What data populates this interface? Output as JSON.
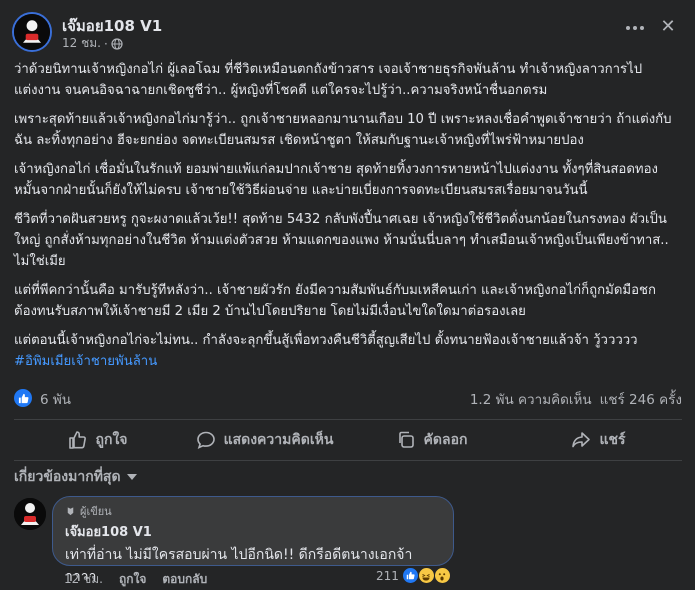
{
  "post": {
    "author": "เจ๊มอย108 V1",
    "time": "12 ชม.",
    "paragraphs": [
      "ว่าด้วยนิทานเจ้าหญิงกอไก่ ผู้เลอโฉม ที่ชีวิตเหมือนตกถังข้าวสาร เจอเจ้าชายธุรกิจพันล้าน ทำเจ้าหญิงลาวการไปแต่งงาน จนคนอิจฉาฉายกเชิดชูชีว่า.. ผู้หญิงที่โชคดี แต่ใครจะไปรู้ว่า..ความจริงหน้าชื่นอกตรม",
      "เพราะสุดท้ายแล้วเจ้าหญิงกอไก่มารู้ว่า.. ถูกเจ้าชายหลอกมานานเกือบ 10 ปี เพราะหลงเชื่อคำพูดเจ้าชายว่า ถ้าแต่งกับฉัน ละทิ้งทุกอย่าง ฮีจะยกย่อง จดทะเบียนสมรส เชิดหน้าชูตา ให้สมกับฐานะเจ้าหญิงที่ไพร่ฟ้าหมายปอง",
      "เจ้าหญิงกอไก่ เชื่อมั่นในรักแท้ ยอมพ่ายแพ้แก่ลมปากเจ้าชาย สุดท้ายทิ้งวงการหายหน้าไปแต่งงาน ทั้งๆที่สินสอดทองหมั้นจากฝ่ายนั้นก็ยังให้ไม่ครบ เจ้าชายใช้วิธีผ่อนจ่าย และบ่ายเบี่ยงการจดทะเบียนสมรสเรื่อยมาจนวันนี้",
      "ชีวิตที่วาดฝันสวยหรู กูจะผงาดแล้วเว้ย!! สุดท้าย 5432 กลับพังปี้นาศเฉย เจ้าหญิงใช้ชีวิตดั่งนกน้อยในกรงทอง ผัวเป็นใหญ่ ถูกสั่งห้ามทุกอย่างในชีวิต ห้ามแต่งตัวสวย ห้ามแดกของแพง ห้ามนั่นนี่บลาๆ ทำเสมือนเจ้าหญิงเป็นเพียงข้าทาส.. ไม่ใช่เมีย",
      "แต่ที่พีคกว่านั้นคือ มารับรู้ทีหลังว่า.. เจ้าชายผัวรัก ยังมีความสัมพันธ์กับมเหสีคนเก่า และเจ้าหญิงกอไก่ก็ถูกมัดมือชก ต้องทนรับสภาพให้เจ้าชายมี 2 เมีย 2 บ้านไปโดยปริยาย โดยไม่มีเงื่อนไขใดใดมาต่อรองเลย",
      "แต่ตอนนี้เจ้าหญิงกอไก่จะไม่ทน.. กำลังจะลุกขึ้นสู้เพื่อทวงคืนชีวิตี้สูญเสียไป ตั้งทนายฟ้องเจ้าชายแล้วจ้า วู้ววววว"
    ],
    "hashtag": "#อิพิมเมียเจ้าชายพันล้าน"
  },
  "stats": {
    "likes": "6 พัน",
    "comments": "1.2 พัน ความคิดเห็น",
    "shares": "แชร์ 246 ครั้ง"
  },
  "actions": {
    "like": "ถูกใจ",
    "comment": "แสดงความคิดเห็น",
    "copy": "คัดลอก",
    "share": "แชร์"
  },
  "filter": {
    "label": "เกี่ยวข้องมากที่สุด"
  },
  "comment": {
    "badge": "ผู้เขียน",
    "author": "เจ๊มอย108 V1",
    "text": "เท่าที่อ่าน ไม่มีใครสอบผ่าน ไปอีกนิด!! ดีกรีอดีตนางเอกจ้าาาาา",
    "time": "12 ชม.",
    "like_label": "ถูกใจ",
    "reply_label": "ตอบกลับ",
    "reaction_count": "211"
  },
  "colors": {
    "background": "#242526",
    "text": "#e4e6eb",
    "secondary": "#b0b3b8",
    "accent": "#2078f4",
    "hashtag": "#4599ff"
  },
  "icons": [
    "globe-icon",
    "more-icon",
    "close-icon",
    "like-icon",
    "comment-icon",
    "copy-icon",
    "share-icon",
    "chevron-down-icon",
    "author-badge-icon",
    "haha-icon",
    "wow-icon"
  ]
}
